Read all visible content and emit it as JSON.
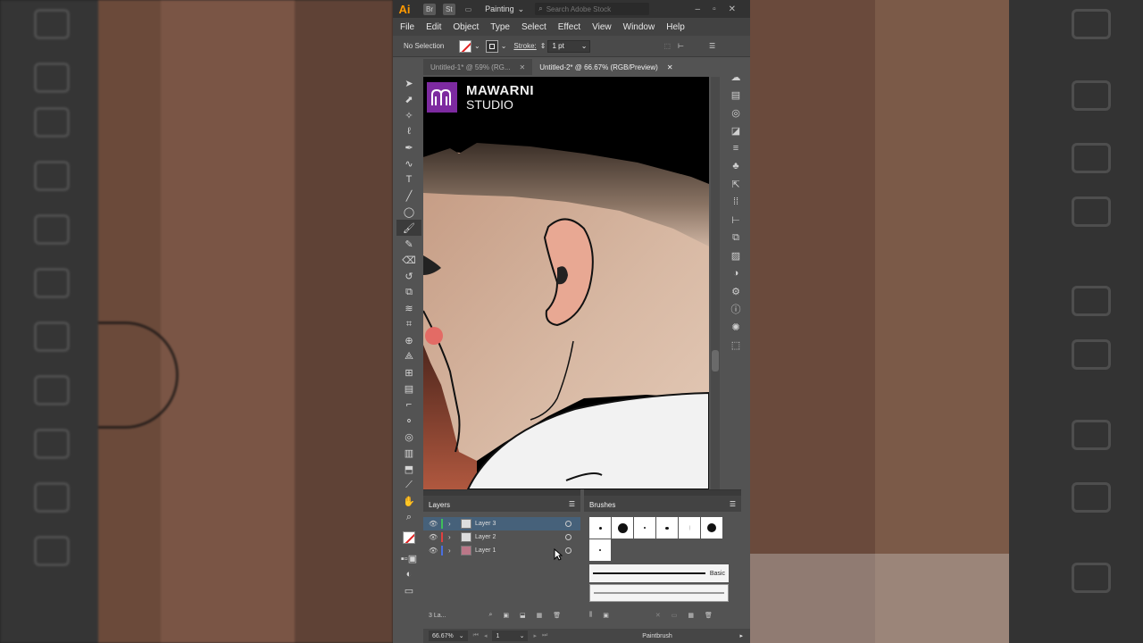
{
  "app": {
    "logo": "Ai",
    "chips": [
      "Br",
      "St"
    ],
    "workspace": "Painting",
    "search_placeholder": "Search Adobe Stock"
  },
  "menu": [
    "File",
    "Edit",
    "Object",
    "Type",
    "Select",
    "Effect",
    "View",
    "Window",
    "Help"
  ],
  "control": {
    "selection": "No Selection",
    "stroke_label": "Stroke:",
    "stroke_value": "1 pt"
  },
  "tabs": [
    {
      "label": "Untitled-1* @ 59% (RG...",
      "active": false
    },
    {
      "label": "Untitled-2* @ 66.67% (RGB/Preview)",
      "active": true
    }
  ],
  "artwork": {
    "brand_name": "MAWARNI",
    "brand_sub": "STUDIO",
    "brand_color": "#7d2aa0"
  },
  "layers": {
    "title": "Layers",
    "items": [
      {
        "name": "Layer 3",
        "color": "#3fbf5a",
        "selected": true
      },
      {
        "name": "Layer 2",
        "color": "#e04040",
        "selected": false
      },
      {
        "name": "Layer 1",
        "color": "#4a6fe0",
        "selected": false
      }
    ],
    "footer": "3 La..."
  },
  "brushes": {
    "title": "Brushes",
    "basic_label": "Basic"
  },
  "status": {
    "zoom": "66.67%",
    "artboard": "1",
    "tool": "Paintbrush"
  },
  "colors": {
    "accent": "#ff9a00",
    "selection": "#46617a",
    "panel_bg": "#535353"
  }
}
